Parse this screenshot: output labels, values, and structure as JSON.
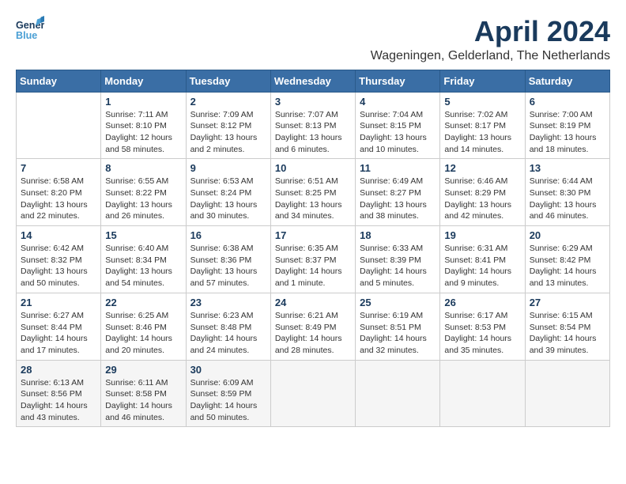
{
  "header": {
    "logo_line1": "General",
    "logo_line2": "Blue",
    "month": "April 2024",
    "location": "Wageningen, Gelderland, The Netherlands"
  },
  "weekdays": [
    "Sunday",
    "Monday",
    "Tuesday",
    "Wednesday",
    "Thursday",
    "Friday",
    "Saturday"
  ],
  "weeks": [
    [
      {
        "day": "",
        "sunrise": "",
        "sunset": "",
        "daylight": ""
      },
      {
        "day": "1",
        "sunrise": "Sunrise: 7:11 AM",
        "sunset": "Sunset: 8:10 PM",
        "daylight": "Daylight: 12 hours and 58 minutes."
      },
      {
        "day": "2",
        "sunrise": "Sunrise: 7:09 AM",
        "sunset": "Sunset: 8:12 PM",
        "daylight": "Daylight: 13 hours and 2 minutes."
      },
      {
        "day": "3",
        "sunrise": "Sunrise: 7:07 AM",
        "sunset": "Sunset: 8:13 PM",
        "daylight": "Daylight: 13 hours and 6 minutes."
      },
      {
        "day": "4",
        "sunrise": "Sunrise: 7:04 AM",
        "sunset": "Sunset: 8:15 PM",
        "daylight": "Daylight: 13 hours and 10 minutes."
      },
      {
        "day": "5",
        "sunrise": "Sunrise: 7:02 AM",
        "sunset": "Sunset: 8:17 PM",
        "daylight": "Daylight: 13 hours and 14 minutes."
      },
      {
        "day": "6",
        "sunrise": "Sunrise: 7:00 AM",
        "sunset": "Sunset: 8:19 PM",
        "daylight": "Daylight: 13 hours and 18 minutes."
      }
    ],
    [
      {
        "day": "7",
        "sunrise": "Sunrise: 6:58 AM",
        "sunset": "Sunset: 8:20 PM",
        "daylight": "Daylight: 13 hours and 22 minutes."
      },
      {
        "day": "8",
        "sunrise": "Sunrise: 6:55 AM",
        "sunset": "Sunset: 8:22 PM",
        "daylight": "Daylight: 13 hours and 26 minutes."
      },
      {
        "day": "9",
        "sunrise": "Sunrise: 6:53 AM",
        "sunset": "Sunset: 8:24 PM",
        "daylight": "Daylight: 13 hours and 30 minutes."
      },
      {
        "day": "10",
        "sunrise": "Sunrise: 6:51 AM",
        "sunset": "Sunset: 8:25 PM",
        "daylight": "Daylight: 13 hours and 34 minutes."
      },
      {
        "day": "11",
        "sunrise": "Sunrise: 6:49 AM",
        "sunset": "Sunset: 8:27 PM",
        "daylight": "Daylight: 13 hours and 38 minutes."
      },
      {
        "day": "12",
        "sunrise": "Sunrise: 6:46 AM",
        "sunset": "Sunset: 8:29 PM",
        "daylight": "Daylight: 13 hours and 42 minutes."
      },
      {
        "day": "13",
        "sunrise": "Sunrise: 6:44 AM",
        "sunset": "Sunset: 8:30 PM",
        "daylight": "Daylight: 13 hours and 46 minutes."
      }
    ],
    [
      {
        "day": "14",
        "sunrise": "Sunrise: 6:42 AM",
        "sunset": "Sunset: 8:32 PM",
        "daylight": "Daylight: 13 hours and 50 minutes."
      },
      {
        "day": "15",
        "sunrise": "Sunrise: 6:40 AM",
        "sunset": "Sunset: 8:34 PM",
        "daylight": "Daylight: 13 hours and 54 minutes."
      },
      {
        "day": "16",
        "sunrise": "Sunrise: 6:38 AM",
        "sunset": "Sunset: 8:36 PM",
        "daylight": "Daylight: 13 hours and 57 minutes."
      },
      {
        "day": "17",
        "sunrise": "Sunrise: 6:35 AM",
        "sunset": "Sunset: 8:37 PM",
        "daylight": "Daylight: 14 hours and 1 minute."
      },
      {
        "day": "18",
        "sunrise": "Sunrise: 6:33 AM",
        "sunset": "Sunset: 8:39 PM",
        "daylight": "Daylight: 14 hours and 5 minutes."
      },
      {
        "day": "19",
        "sunrise": "Sunrise: 6:31 AM",
        "sunset": "Sunset: 8:41 PM",
        "daylight": "Daylight: 14 hours and 9 minutes."
      },
      {
        "day": "20",
        "sunrise": "Sunrise: 6:29 AM",
        "sunset": "Sunset: 8:42 PM",
        "daylight": "Daylight: 14 hours and 13 minutes."
      }
    ],
    [
      {
        "day": "21",
        "sunrise": "Sunrise: 6:27 AM",
        "sunset": "Sunset: 8:44 PM",
        "daylight": "Daylight: 14 hours and 17 minutes."
      },
      {
        "day": "22",
        "sunrise": "Sunrise: 6:25 AM",
        "sunset": "Sunset: 8:46 PM",
        "daylight": "Daylight: 14 hours and 20 minutes."
      },
      {
        "day": "23",
        "sunrise": "Sunrise: 6:23 AM",
        "sunset": "Sunset: 8:48 PM",
        "daylight": "Daylight: 14 hours and 24 minutes."
      },
      {
        "day": "24",
        "sunrise": "Sunrise: 6:21 AM",
        "sunset": "Sunset: 8:49 PM",
        "daylight": "Daylight: 14 hours and 28 minutes."
      },
      {
        "day": "25",
        "sunrise": "Sunrise: 6:19 AM",
        "sunset": "Sunset: 8:51 PM",
        "daylight": "Daylight: 14 hours and 32 minutes."
      },
      {
        "day": "26",
        "sunrise": "Sunrise: 6:17 AM",
        "sunset": "Sunset: 8:53 PM",
        "daylight": "Daylight: 14 hours and 35 minutes."
      },
      {
        "day": "27",
        "sunrise": "Sunrise: 6:15 AM",
        "sunset": "Sunset: 8:54 PM",
        "daylight": "Daylight: 14 hours and 39 minutes."
      }
    ],
    [
      {
        "day": "28",
        "sunrise": "Sunrise: 6:13 AM",
        "sunset": "Sunset: 8:56 PM",
        "daylight": "Daylight: 14 hours and 43 minutes."
      },
      {
        "day": "29",
        "sunrise": "Sunrise: 6:11 AM",
        "sunset": "Sunset: 8:58 PM",
        "daylight": "Daylight: 14 hours and 46 minutes."
      },
      {
        "day": "30",
        "sunrise": "Sunrise: 6:09 AM",
        "sunset": "Sunset: 8:59 PM",
        "daylight": "Daylight: 14 hours and 50 minutes."
      },
      {
        "day": "",
        "sunrise": "",
        "sunset": "",
        "daylight": ""
      },
      {
        "day": "",
        "sunrise": "",
        "sunset": "",
        "daylight": ""
      },
      {
        "day": "",
        "sunrise": "",
        "sunset": "",
        "daylight": ""
      },
      {
        "day": "",
        "sunrise": "",
        "sunset": "",
        "daylight": ""
      }
    ]
  ]
}
